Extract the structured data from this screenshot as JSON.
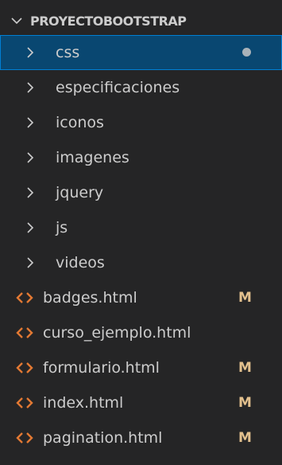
{
  "explorer": {
    "section_title": "PROYECTOBOOTSTRAP",
    "folders": [
      {
        "label": "css",
        "selected": true,
        "has_dot": true
      },
      {
        "label": "especificaciones"
      },
      {
        "label": "iconos"
      },
      {
        "label": "imagenes"
      },
      {
        "label": "jquery"
      },
      {
        "label": "js"
      },
      {
        "label": "videos"
      }
    ],
    "files": [
      {
        "label": "badges.html",
        "status": "M"
      },
      {
        "label": "curso_ejemplo.html",
        "status": ""
      },
      {
        "label": "formulario.html",
        "status": "M"
      },
      {
        "label": "index.html",
        "status": "M"
      },
      {
        "label": "pagination.html",
        "status": "M"
      }
    ]
  },
  "colors": {
    "background": "#252526",
    "selection": "#094771",
    "html_icon": "#e37933",
    "text": "#cccccc",
    "modified": "#e2c08d"
  }
}
